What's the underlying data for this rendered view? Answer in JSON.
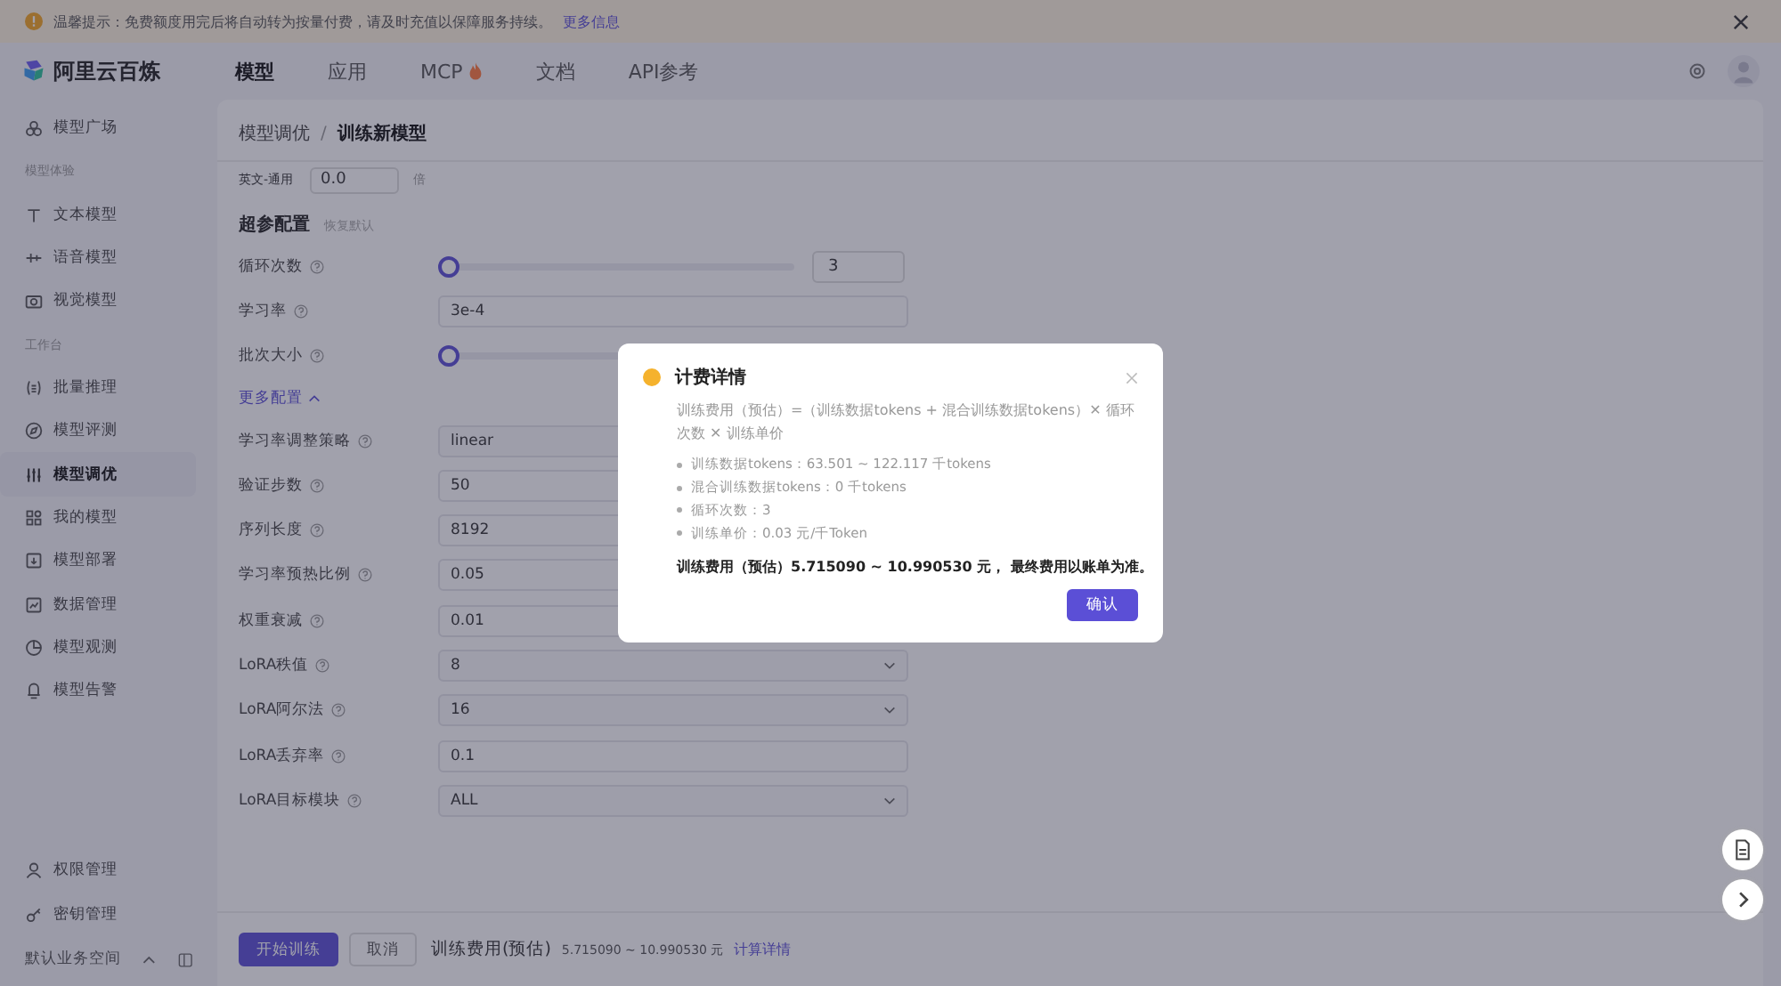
{
  "notice": {
    "text": "温馨提示：免费额度用完后将自动转为按量付费，请及时充值以保障服务持续。",
    "link": "更多信息"
  },
  "logo": "阿里云百炼",
  "nav": [
    {
      "label": "模型",
      "selected": true,
      "hot": false
    },
    {
      "label": "应用",
      "selected": false,
      "hot": false
    },
    {
      "label": "MCP",
      "selected": false,
      "hot": true
    },
    {
      "label": "文档",
      "selected": false,
      "hot": false
    },
    {
      "label": "API参考",
      "selected": false,
      "hot": false
    }
  ],
  "sidebar": {
    "items": [
      {
        "kind": "item",
        "label": "模型广场",
        "selected": false
      },
      {
        "kind": "section",
        "label": "模型体验"
      },
      {
        "kind": "item",
        "label": "文本模型",
        "selected": false
      },
      {
        "kind": "item",
        "label": "语音模型",
        "selected": false
      },
      {
        "kind": "item",
        "label": "视觉模型",
        "selected": false
      },
      {
        "kind": "section",
        "label": "工作台"
      },
      {
        "kind": "item",
        "label": "批量推理",
        "selected": false
      },
      {
        "kind": "item",
        "label": "模型评测",
        "selected": false
      },
      {
        "kind": "item",
        "label": "模型调优",
        "selected": true
      },
      {
        "kind": "item",
        "label": "我的模型",
        "selected": false
      },
      {
        "kind": "item",
        "label": "模型部署",
        "selected": false
      },
      {
        "kind": "item",
        "label": "数据管理",
        "selected": false
      },
      {
        "kind": "item",
        "label": "模型观测",
        "selected": false
      },
      {
        "kind": "item",
        "label": "模型告警",
        "selected": false
      }
    ],
    "bottom_items": [
      {
        "label": "权限管理"
      },
      {
        "label": "密钥管理"
      }
    ],
    "workspace": "默认业务空间"
  },
  "breadcrumb": [
    "模型调优",
    "训练新模型"
  ],
  "breadcrumb_separator": "/",
  "ratio_row": {
    "label": "英文-通用",
    "value": "0.0",
    "unit": "倍"
  },
  "section": {
    "title": "超参配置",
    "reset": "恢复默认"
  },
  "fields": [
    {
      "kind": "slider",
      "label": "循环次数",
      "level": 0,
      "value": "3"
    },
    {
      "kind": "input",
      "label": "学习率",
      "value": "3e-4"
    },
    {
      "kind": "slider",
      "label": "批次大小",
      "level": 0
    }
  ],
  "more_config": {
    "label": "更多配置",
    "expanded": true
  },
  "more_fields": [
    {
      "kind": "select",
      "label": "学习率调整策略",
      "value": "linear"
    },
    {
      "kind": "input",
      "label": "验证步数",
      "value": "50"
    },
    {
      "kind": "input",
      "label": "序列长度",
      "value": "8192"
    },
    {
      "kind": "input",
      "label": "学习率预热比例",
      "value": "0.05"
    },
    {
      "kind": "input",
      "label": "权重衰减",
      "value": "0.01"
    },
    {
      "kind": "select",
      "label": "LoRA秩值",
      "value": "8"
    },
    {
      "kind": "select",
      "label": "LoRA阿尔法",
      "value": "16"
    },
    {
      "kind": "input",
      "label": "LoRA丢弃率",
      "value": "0.1"
    },
    {
      "kind": "select",
      "label": "LoRA目标模块",
      "value": "ALL"
    }
  ],
  "footer": {
    "start": "开始训练",
    "cancel": "取消",
    "cost_label": "训练费用(预估)",
    "cost_value": "5.715090 ~ 10.990530 元",
    "link": "计算详情"
  },
  "modal": {
    "title": "计费详情",
    "formula": "训练费用（预估）=（训练数据tokens + 混合训练数据tokens）✕ 循环次数 ✕ 训练单价",
    "bullets": [
      "训练数据tokens：63.501 ~ 122.117 千tokens",
      "混合训练数据tokens：0 千tokens",
      "循环次数：3",
      "训练单价：0.03 元/千Token"
    ],
    "summary": "训练费用（预估）5.715090 ~ 10.990530 元， 最终费用以账单为准。",
    "confirm": "确认"
  }
}
